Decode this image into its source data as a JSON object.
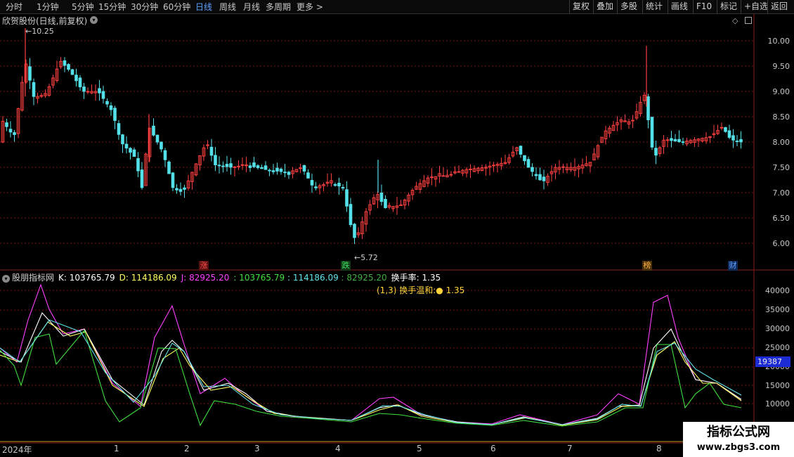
{
  "toolbar": {
    "periods": [
      "分时",
      "1分钟",
      "5分钟",
      "15分钟",
      "30分钟",
      "60分钟",
      "日线",
      "周线",
      "月线",
      "多周期",
      "更多"
    ],
    "active_period": "日线",
    "buttons": [
      "复权",
      "叠加",
      "多股",
      "统计",
      "画线",
      "F10",
      "标记",
      "+自选",
      "返回"
    ]
  },
  "stock": {
    "title": "欣贺股份(日线,前复权)"
  },
  "price_axis": [
    "10.00",
    "9.50",
    "9.00",
    "8.50",
    "8.00",
    "7.50",
    "7.00",
    "6.50",
    "6.00"
  ],
  "annotations": {
    "high": "10.25",
    "low": "5.72"
  },
  "tags": [
    {
      "text": "涨",
      "color": "#e0303a"
    },
    {
      "text": "跌",
      "color": "#22aa44"
    },
    {
      "text": "榜",
      "color": "#e0a030"
    },
    {
      "text": "财",
      "color": "#3a78d8"
    }
  ],
  "indicator": {
    "name": "股朋指标网",
    "k_label": "K:",
    "k_value": "103765.79",
    "d_label": "D:",
    "d_value": "114186.09",
    "j_label": "J:",
    "j_value": "82925.20",
    "v1": ": 103765.79",
    "v2": ": 114186.09",
    "v3": ": 82925.20",
    "turnover_label": "换手率:",
    "turnover_value": "1.35",
    "tip": "(1,3) 换手温和:● 1.35",
    "current_value": "19387",
    "axis": [
      "40000",
      "35000",
      "30000",
      "25000",
      "20000",
      "15000",
      "10000"
    ]
  },
  "time_axis": {
    "year": "2024年",
    "months": [
      "1",
      "2",
      "3",
      "4",
      "5",
      "6",
      "7",
      "8"
    ]
  },
  "watermark": {
    "line1": "指标公式网",
    "line2": "www.zbgs3.com"
  },
  "colors": {
    "up": "#ff4040",
    "down": "#54e0e8",
    "k_line": "#ffffff",
    "d_line": "#ffff60",
    "j_line": "#ff40ff",
    "green_line": "#40e040",
    "cyan_line": "#60e0e8"
  }
}
